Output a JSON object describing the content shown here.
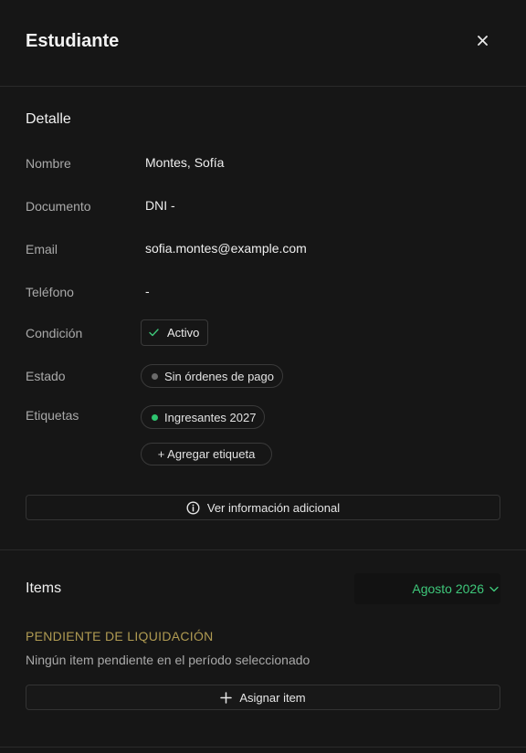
{
  "header": {
    "title": "Estudiante",
    "close_icon": "close-icon"
  },
  "detail": {
    "section_title": "Detalle",
    "fields": {
      "name_label": "Nombre",
      "name_value": "Montes, Sofía",
      "document_label": "Documento",
      "document_value": "DNI -",
      "email_label": "Email",
      "email_value": "sofia.montes@example.com",
      "phone_label": "Teléfono",
      "phone_value": "-",
      "condition_label": "Condición",
      "condition_value": "Activo",
      "state_label": "Estado",
      "state_value": "Sin órdenes de pago",
      "tags_label": "Etiquetas",
      "tag_1": "Ingresantes 2027"
    },
    "add_tag_label": "+ Agregar etiqueta",
    "more_info_label": "Ver información adicional"
  },
  "items": {
    "section_title": "Items",
    "period_label": "Agosto 2026",
    "pending_title": "PENDIENTE DE LIQUIDACIÓN",
    "pending_message": "Ningún item pendiente en el período seleccionado",
    "assign_label": "Asignar item"
  },
  "colors": {
    "background": "#161616",
    "accent_green": "#3ec77a",
    "pending_gold": "#b09b52",
    "state_dot_gray": "#6a6a6a",
    "tag_dot_green": "#2ec46f"
  }
}
